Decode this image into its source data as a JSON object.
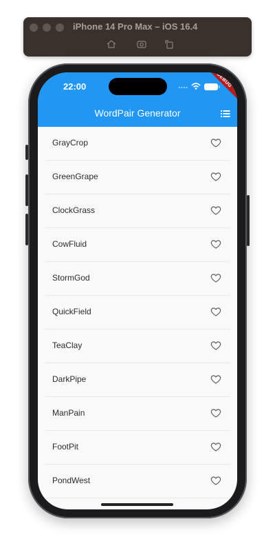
{
  "simulator": {
    "title": "iPhone 14 Pro Max – iOS 16.4",
    "tools": [
      "home-icon",
      "screenshot-icon",
      "rotate-icon"
    ]
  },
  "status_bar": {
    "time": "22:00",
    "debug_banner": "DEBUG"
  },
  "app_bar": {
    "title": "WordPair Generator",
    "background": "#2196f3",
    "action_icon": "list-icon"
  },
  "word_pairs": [
    "GrayCrop",
    "GreenGrape",
    "ClockGrass",
    "CowFluid",
    "StormGod",
    "QuickField",
    "TeaClay",
    "DarkPipe",
    "ManPain",
    "FootPit",
    "PondWest"
  ]
}
